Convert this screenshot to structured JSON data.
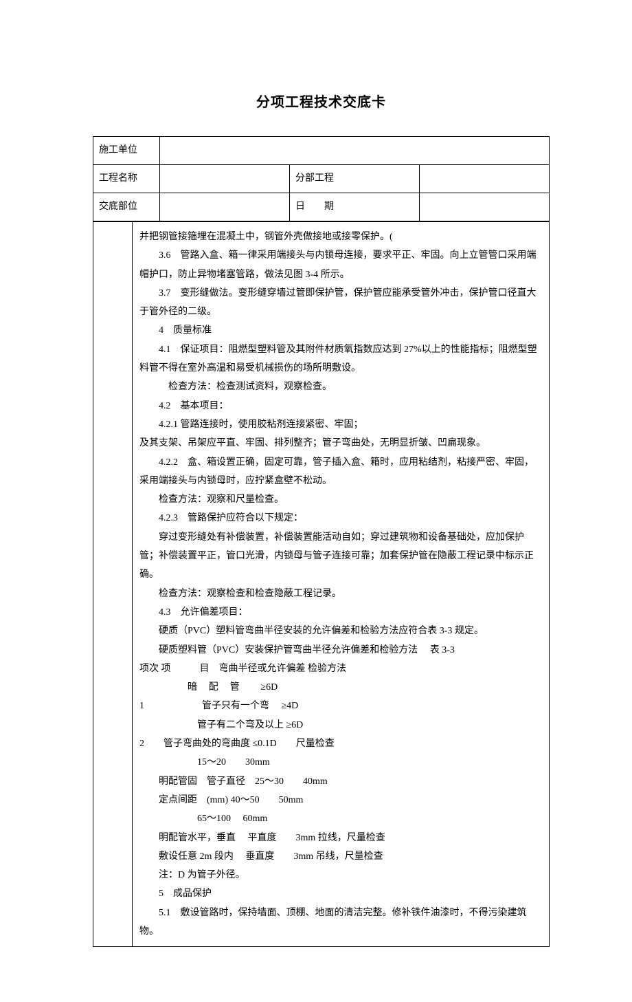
{
  "title": "分项工程技术交底卡",
  "header": {
    "row1_label": "施工单位",
    "row1_value": "",
    "row2_label": "工程名称",
    "row2_value": "",
    "row2_mid_label": "分部工程",
    "row2_mid_value": "",
    "row3_label": "交底部位",
    "row3_value": "",
    "row3_mid_label": "日　　期",
    "row3_mid_value": ""
  },
  "body": {
    "p00": "并把钢管接箍埋在混凝土中，钢管外壳做接地或接零保护。(",
    "p01": "3.6　管路入盒、箱一律采用端接头与内锁母连接，要求平正、牢固。向上立管管口采用端帽护口，防止异物堵塞管路，做法见图 3-4 所示。",
    "p02": "3.7　变形缝做法。变形缝穿墙过管即保护管，保护管应能承受管外冲击，保护管口径直大于管外径的二级。",
    "p03": "4　质量标准",
    "p04": "4.1　保证项目：阻燃型塑料管及其附件材质氧指数应达到 27%以上的性能指标；阻燃型塑料管不得在室外高温和易受机械损伤的场所明敷设。",
    "p05": "检查方法：检查测试资料，观察检查。",
    "p06": "4.2　基本项目：",
    "p07": "4.2.1  管路连接时，使用胶粘剂连接紧密、牢固；",
    "p08": "及其支架、吊架应平直、牢固、排列整齐；管子弯曲处，无明显折皱、凹扁现象。",
    "p09": "4.2.2　盒、箱设置正确，固定可靠，管子插入盒、箱时，应用粘结剂，粘接严密、牢固，采用端接头与内锁母时，应拧紧盒壁不松动。",
    "p10": "检查方法：观察和尺量检查。",
    "p11": "4.2.3　管路保护应符合以下规定：",
    "p12": "穿过变形缝处有补偿装置，补偿装置能活动自如；穿过建筑物和设备基础处，应加保护管；补偿装置平正，管口光滑，内锁母与管子连接可靠；加套保护管在隐蔽工程记录中标示正确。",
    "p13": "检查方法：观察检查和检查隐蔽工程记录。",
    "p14": "4.3　允许偏差项目：",
    "p15": "硬质（PVC）塑料管弯曲半径安装的允许偏差和检验方法应符合表 3-3 规定。",
    "p16": "硬质塑料管（PVC）安装保护管弯曲半径允许偏差和检验方法　 表 3-3",
    "p17": "项次 项　　　目　弯曲半径或允许偏差 检验方法",
    "p18": "暗　　配　　管　　≥6D",
    "p19": "1　　　　　　管子只有一个弯　 ≥4D",
    "p20": "管子有二个弯及以上 ≥6D",
    "p21": "2　　管子弯曲处的弯曲度 ≤0.1D　　尺量检查",
    "p22": "15～20　　30mm",
    "p23": "明配管固　管子直径　25～30　　40mm",
    "p24": "定点间距　(mm) 40～50　　50mm",
    "p25": "65～100　 60mm",
    "p26": "明配管水平，垂直　 平直度　　3mm 拉线，尺量检查",
    "p27": "敷设任意 2m 段内　 垂直度　　3mm 吊线，尺量检查",
    "p28": "注：D 为管子外径。",
    "p29": "5　成品保护",
    "p30": "5.1　敷设管路时，保持墙面、顶棚、地面的清洁完整。修补铁件油漆时，不得污染建筑物。"
  }
}
